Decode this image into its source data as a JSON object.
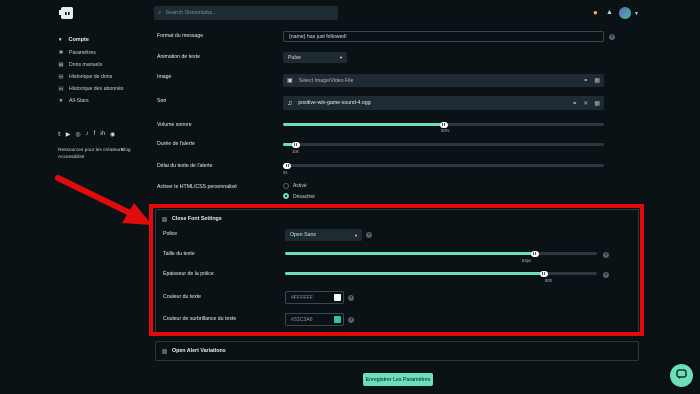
{
  "search": {
    "placeholder": "Search Streamlabs..."
  },
  "sidebar": {
    "heading": "Compte",
    "items": [
      {
        "label": "Paramètres",
        "icon": "gear-icon"
      },
      {
        "label": "Dons manuels",
        "icon": "calendar-icon"
      },
      {
        "label": "Historique de dons",
        "icon": "list-icon"
      },
      {
        "label": "Historique des abonnés",
        "icon": "list-icon"
      },
      {
        "label": "All-Stars",
        "icon": "star-icon"
      }
    ],
    "social_icons": [
      "twitter-icon",
      "youtube-icon",
      "instagram-icon",
      "tiktok-icon",
      "facebook-icon",
      "linkedin-icon",
      "discord-icon"
    ],
    "footer_links": [
      "Ressources pour les créateurs",
      "Blog",
      "Accessibilité"
    ]
  },
  "form": {
    "message_format": {
      "label": "Format du message",
      "value": "{name} has just followed!"
    },
    "text_animation": {
      "label": "Animation de texte",
      "value": "Pulse"
    },
    "image": {
      "label": "Image",
      "value": "Select Image/Video File"
    },
    "sound": {
      "label": "Son",
      "value": "positive-win-game-sound-4.ogg"
    },
    "volume": {
      "label": "Volume sonore",
      "value_text": "50%",
      "fraction": 0.5
    },
    "duration": {
      "label": "Durée de l'alerte",
      "value_text": "10s",
      "fraction": 0.04
    },
    "text_delay": {
      "label": "Délai du texte de l'alerte",
      "value_text": "0s",
      "fraction": 0.0
    },
    "custom_html": {
      "label": "Activer le HTML/CSS personnalisé",
      "options": [
        "Activé",
        "Désactivé"
      ],
      "selected": "Désactivé"
    }
  },
  "font_settings": {
    "title": "Close Font Settings",
    "font": {
      "label": "Police",
      "value": "Open Sans"
    },
    "text_size": {
      "label": "Taille du texte",
      "value_text": "64px",
      "fraction": 0.8
    },
    "font_weight": {
      "label": "Épaisseur de la police",
      "value_text": "800",
      "fraction": 0.83
    },
    "text_color": {
      "label": "Couleur du texte",
      "value": "#FFFFFF"
    },
    "highlight_color": {
      "label": "Couleur de surbrillance du texte",
      "value": "#32C3A6"
    }
  },
  "alert_variations": {
    "title": "Open Alert Variations"
  },
  "save_label": "Enregistrer Les Paramètres",
  "colors": {
    "accent": "#6cdfb8",
    "annotation": "#e10b0b",
    "background": "#0b1216"
  }
}
